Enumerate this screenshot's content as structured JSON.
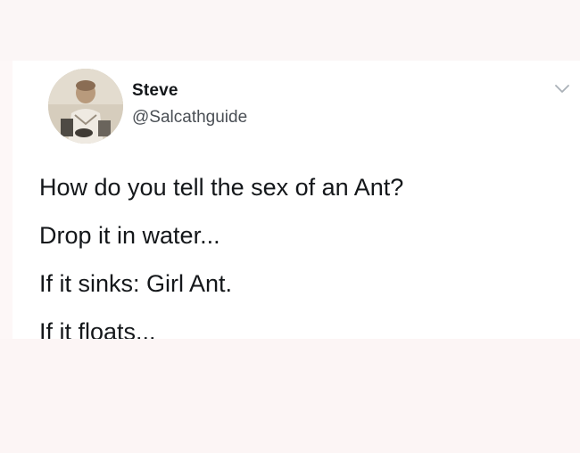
{
  "tweet": {
    "author": {
      "display_name": "Steve",
      "handle": "@Salcathguide",
      "avatar_icon": "avatar-photo-boy"
    },
    "menu_icon": "chevron-down-icon",
    "lines": [
      "How do you tell the sex of an Ant?",
      "Drop it in water...",
      "If it sinks: Girl Ant.",
      "If it floats..."
    ]
  },
  "colors": {
    "text": "#14171a",
    "handle": "#4a4f55",
    "card_background": "#ffffff",
    "page_background": "#fdf7f7",
    "chevron": "#aab1b8"
  }
}
